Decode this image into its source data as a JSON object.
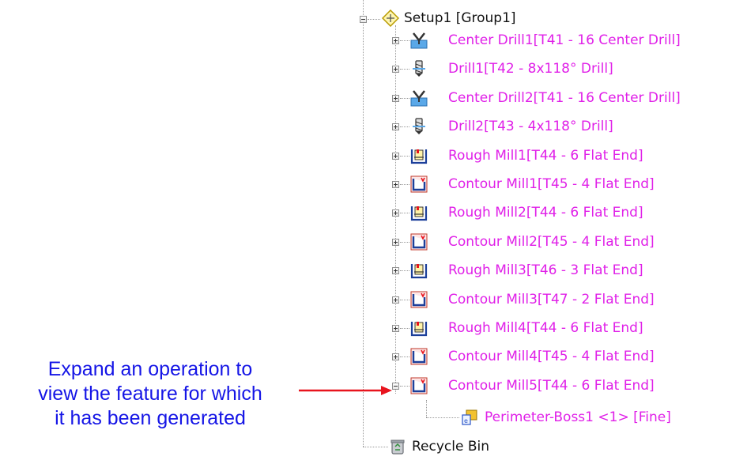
{
  "tree": {
    "root": {
      "label": "Setup1 [Group1]",
      "icon": "setup-icon"
    },
    "operations": [
      {
        "label": "Center Drill1[T41 - 16 Center Drill]",
        "icon": "center-drill-icon"
      },
      {
        "label": "Drill1[T42 - 8x118° Drill]",
        "icon": "drill-icon"
      },
      {
        "label": "Center Drill2[T41 - 16 Center Drill]",
        "icon": "center-drill-icon"
      },
      {
        "label": "Drill2[T43 - 4x118° Drill]",
        "icon": "drill-icon"
      },
      {
        "label": "Rough Mill1[T44 - 6 Flat End]",
        "icon": "rough-mill-icon"
      },
      {
        "label": "Contour Mill1[T45 - 4 Flat End]",
        "icon": "contour-mill-icon"
      },
      {
        "label": "Rough Mill2[T44 - 6 Flat End]",
        "icon": "rough-mill-icon"
      },
      {
        "label": "Contour Mill2[T45 - 4 Flat End]",
        "icon": "contour-mill-icon"
      },
      {
        "label": "Rough Mill3[T46 - 3 Flat End]",
        "icon": "rough-mill-icon"
      },
      {
        "label": "Contour Mill3[T47 - 2 Flat End]",
        "icon": "contour-mill-icon"
      },
      {
        "label": "Rough Mill4[T44 - 6 Flat End]",
        "icon": "rough-mill-icon"
      },
      {
        "label": "Contour Mill4[T45 - 4 Flat End]",
        "icon": "contour-mill-icon"
      },
      {
        "label": "Contour Mill5[T44 - 6 Flat End]",
        "icon": "contour-mill-icon",
        "expanded": true
      }
    ],
    "feature": {
      "label": "Perimeter-Boss1 <1> [Fine]",
      "icon": "feature-icon"
    },
    "recycle_bin": {
      "label": "Recycle Bin",
      "icon": "recycle-bin-icon"
    }
  },
  "annotation": {
    "line1": "Expand an operation to",
    "line2": "view the feature for which",
    "line3": "it has been generated"
  },
  "colors": {
    "operation_text": "#e020e8",
    "annotation_text": "#1515e6",
    "arrow": "#e8141e",
    "tree_text": "#111111"
  }
}
